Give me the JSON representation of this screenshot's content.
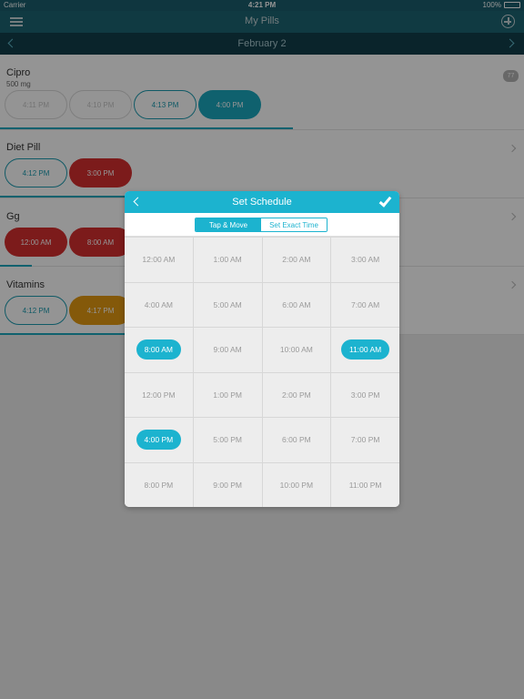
{
  "status": {
    "carrier": "Carrier",
    "time": "4:21 PM",
    "battery": "100%"
  },
  "nav": {
    "title": "My Pills"
  },
  "date_bar": {
    "date": "February 2"
  },
  "meds": [
    {
      "name": "Cipro",
      "dose": "500 mg",
      "badge": "77",
      "times": [
        {
          "label": "4:11 PM",
          "style": "outline-faint"
        },
        {
          "label": "4:10 PM",
          "style": "outline-faint"
        },
        {
          "label": "4:13 PM",
          "style": "outline"
        },
        {
          "label": "4:00 PM",
          "style": "teal"
        }
      ]
    },
    {
      "name": "Diet Pill",
      "times": [
        {
          "label": "4:12 PM",
          "style": "outline"
        },
        {
          "label": "3:00 PM",
          "style": "red"
        }
      ]
    },
    {
      "name": "Gg",
      "times": [
        {
          "label": "12:00 AM",
          "style": "red"
        },
        {
          "label": "8:00 AM",
          "style": "red"
        }
      ]
    },
    {
      "name": "Vitamins",
      "times": [
        {
          "label": "4:12 PM",
          "style": "outline"
        },
        {
          "label": "4:17 PM",
          "style": "amber"
        }
      ]
    }
  ],
  "modal": {
    "title": "Set Schedule",
    "segments": [
      "Tap & Move",
      "Set Exact Time"
    ],
    "active_segment": 0,
    "hours": [
      {
        "label": "12:00 AM",
        "selected": false
      },
      {
        "label": "1:00 AM",
        "selected": false
      },
      {
        "label": "2:00 AM",
        "selected": false
      },
      {
        "label": "3:00 AM",
        "selected": false
      },
      {
        "label": "4:00 AM",
        "selected": false
      },
      {
        "label": "5:00 AM",
        "selected": false
      },
      {
        "label": "6:00 AM",
        "selected": false
      },
      {
        "label": "7:00 AM",
        "selected": false
      },
      {
        "label": "8:00 AM",
        "selected": true
      },
      {
        "label": "9:00 AM",
        "selected": false
      },
      {
        "label": "10:00 AM",
        "selected": false
      },
      {
        "label": "11:00 AM",
        "selected": true
      },
      {
        "label": "12:00 PM",
        "selected": false
      },
      {
        "label": "1:00 PM",
        "selected": false
      },
      {
        "label": "2:00 PM",
        "selected": false
      },
      {
        "label": "3:00 PM",
        "selected": false
      },
      {
        "label": "4:00 PM",
        "selected": true
      },
      {
        "label": "5:00 PM",
        "selected": false
      },
      {
        "label": "6:00 PM",
        "selected": false
      },
      {
        "label": "7:00 PM",
        "selected": false
      },
      {
        "label": "8:00 PM",
        "selected": false
      },
      {
        "label": "9:00 PM",
        "selected": false
      },
      {
        "label": "10:00 PM",
        "selected": false
      },
      {
        "label": "11:00 PM",
        "selected": false
      }
    ]
  },
  "colors": {
    "accent": "#1cb3cf",
    "nav": "#1c6473",
    "date_bar": "#123e4b",
    "missed": "#d62f2f",
    "pending": "#e49a12"
  }
}
